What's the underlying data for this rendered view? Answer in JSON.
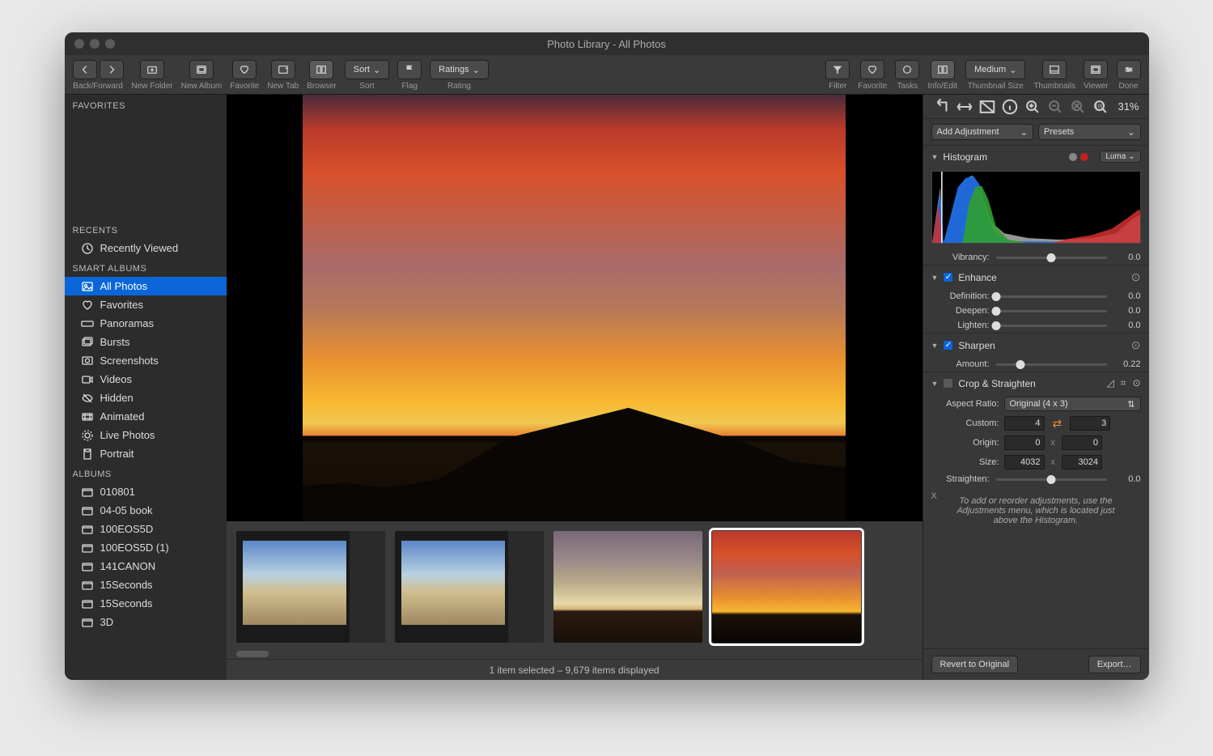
{
  "window": {
    "title": "Photo Library - All Photos"
  },
  "toolbar": {
    "back_forward": "Back/Forward",
    "new_folder": "New Folder",
    "new_album": "New Album",
    "favorite": "Favorite",
    "new_tab": "New Tab",
    "browser": "Browser",
    "sort_menu": "Sort",
    "sort_label": "Sort",
    "flag": "Flag",
    "ratings_menu": "Ratings",
    "rating_label": "Rating",
    "filter": "Filter",
    "favorite2": "Favorite",
    "tasks": "Tasks",
    "info_edit": "Info/Edit",
    "thumb_size_menu": "Medium",
    "thumb_size_label": "Thumbnail Size",
    "thumbnails": "Thumbnails",
    "viewer": "Viewer",
    "done": "Done"
  },
  "sidebar": {
    "favorites_header": "FAVORITES",
    "recents_header": "RECENTS",
    "recently_viewed": "Recently Viewed",
    "smart_header": "SMART ALBUMS",
    "smart": [
      "All Photos",
      "Favorites",
      "Panoramas",
      "Bursts",
      "Screenshots",
      "Videos",
      "Hidden",
      "Animated",
      "Live Photos",
      "Portrait"
    ],
    "albums_header": "ALBUMS",
    "albums": [
      "010801",
      "04-05 book",
      "100EOS5D",
      "100EOS5D (1)",
      "141CANON",
      "15Seconds",
      "15Seconds",
      "3D"
    ]
  },
  "status": {
    "text": "1 item selected – 9,679 items displayed"
  },
  "inspector": {
    "zoom": "31%",
    "add_adjustment": "Add Adjustment",
    "presets": "Presets",
    "histogram": {
      "title": "Histogram",
      "mode": "Luma"
    },
    "vibrancy": {
      "label": "Vibrancy:",
      "value": "0.0",
      "pos": 50
    },
    "enhance": {
      "title": "Enhance",
      "definition": {
        "label": "Definition:",
        "value": "0.0",
        "pos": 0
      },
      "deepen": {
        "label": "Deepen:",
        "value": "0.0",
        "pos": 0
      },
      "lighten": {
        "label": "Lighten:",
        "value": "0.0",
        "pos": 0
      }
    },
    "sharpen": {
      "title": "Sharpen",
      "amount": {
        "label": "Amount:",
        "value": "0.22",
        "pos": 22
      }
    },
    "crop": {
      "title": "Crop & Straighten",
      "aspect_label": "Aspect Ratio:",
      "aspect_value": "Original (4 x 3)",
      "custom_label": "Custom:",
      "custom_w": "4",
      "custom_h": "3",
      "origin_label": "Origin:",
      "origin_x": "0",
      "origin_y": "0",
      "size_label": "Size:",
      "size_w": "4032",
      "size_h": "3024",
      "straighten": {
        "label": "Straighten:",
        "value": "0.0",
        "pos": 50
      }
    },
    "help": "To add or reorder adjustments, use the Adjustments menu, which is located just above the Histogram.",
    "revert": "Revert to Original",
    "export": "Export…"
  }
}
